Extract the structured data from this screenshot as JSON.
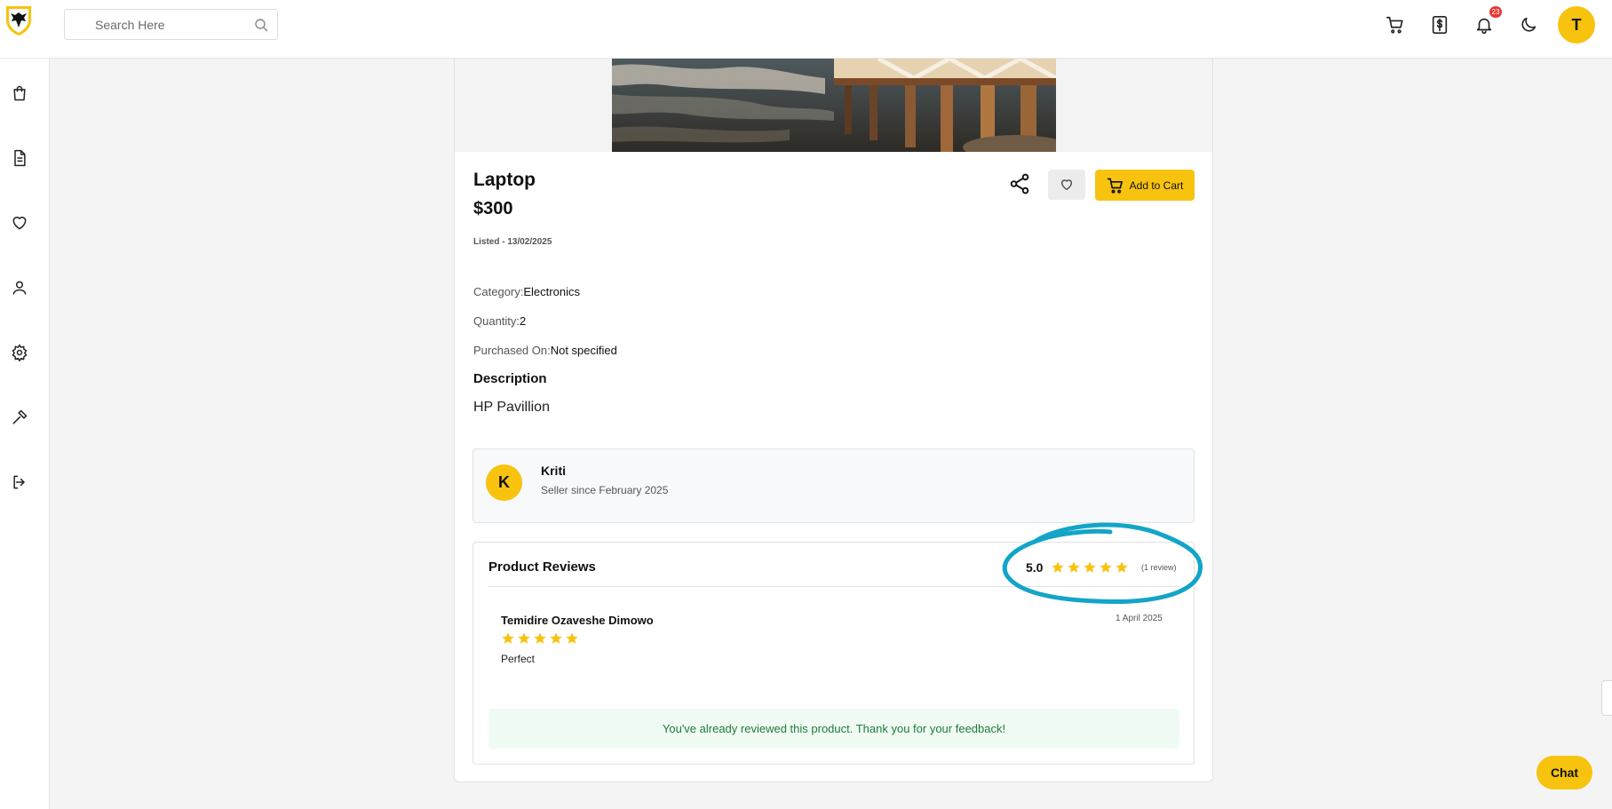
{
  "search": {
    "placeholder": "Search Here"
  },
  "header": {
    "notification_count": "23",
    "user_initial": "T"
  },
  "product": {
    "title": "Laptop",
    "price": "$300",
    "listed": "Listed - 13/02/2025",
    "add_to_cart_label": "Add to Cart",
    "category_label": "Category:",
    "category_value": "Electronics",
    "quantity_label": "Quantity:",
    "quantity_value": "2",
    "purchased_label": "Purchased On:",
    "purchased_value": "Not specified",
    "description_heading": "Description",
    "description": "HP Pavillion"
  },
  "seller": {
    "initial": "K",
    "name": "Kriti",
    "since": "Seller since February 2025"
  },
  "reviews": {
    "title": "Product Reviews",
    "average": "5.0",
    "average_stars": 5,
    "count_text": "(1 review)",
    "items": [
      {
        "author": "Temidire Ozaveshe Dimowo",
        "date": "1 April 2025",
        "stars": 5,
        "text": "Perfect"
      }
    ],
    "notice": "You've already reviewed this product. Thank you for your feedback!"
  },
  "chat_label": "Chat",
  "colors": {
    "accent": "#f7c30f",
    "annotation": "#12a5c8",
    "notice_text": "#1e7b3a",
    "badge": "#e53935"
  },
  "icons": {
    "top": [
      "cart-icon",
      "dollar-icon",
      "bell-icon",
      "moon-icon"
    ],
    "sidebar": [
      "shopping-bag-icon",
      "document-icon",
      "heart-icon",
      "user-icon",
      "gear-icon",
      "gavel-icon",
      "logout-icon"
    ]
  }
}
